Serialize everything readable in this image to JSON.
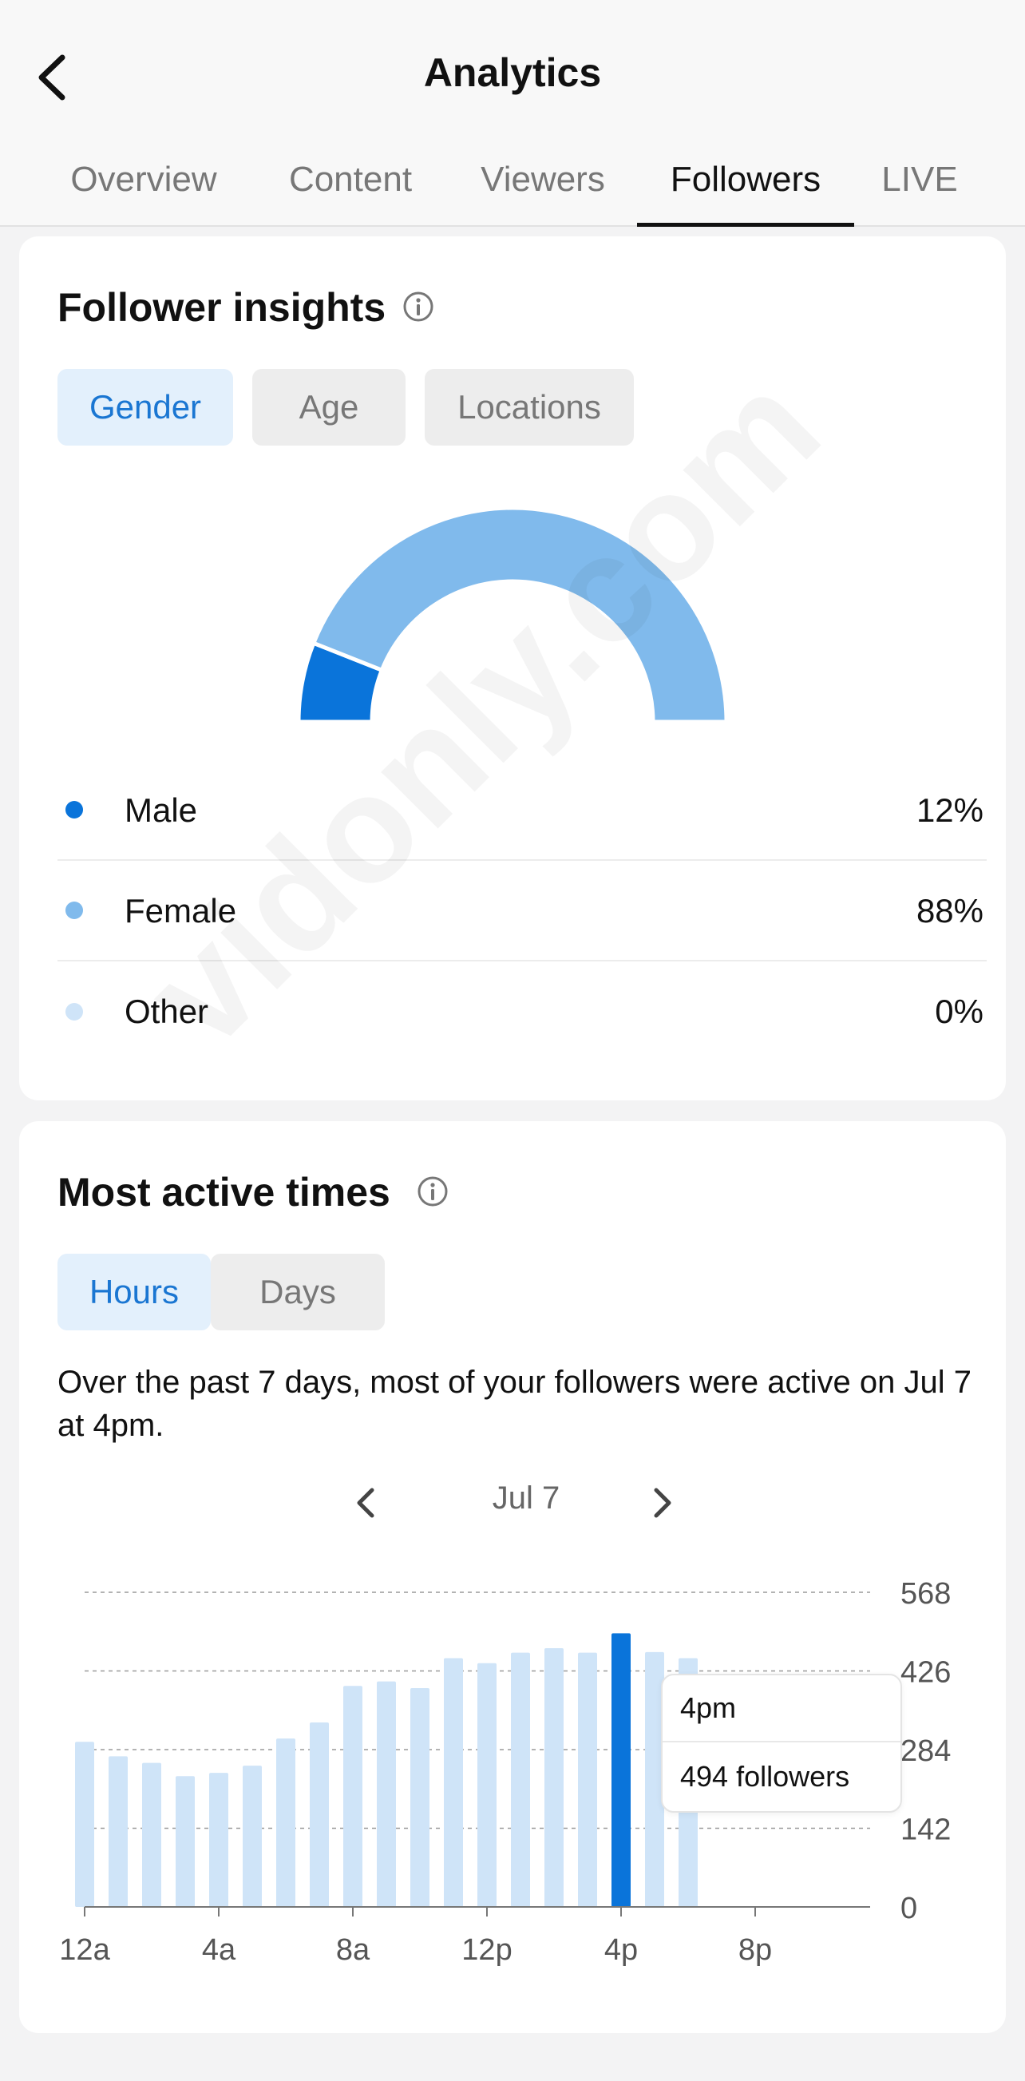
{
  "header": {
    "title": "Analytics",
    "tabs": [
      {
        "label": "Overview"
      },
      {
        "label": "Content"
      },
      {
        "label": "Viewers"
      },
      {
        "label": "Followers"
      },
      {
        "label": "LIVE"
      }
    ],
    "active_tab": "Followers"
  },
  "follower_insights": {
    "title": "Follower insights",
    "filters": [
      {
        "label": "Gender"
      },
      {
        "label": "Age"
      },
      {
        "label": "Locations"
      }
    ],
    "active_filter": "Gender",
    "legend": [
      {
        "label": "Male",
        "value": "12%",
        "color": "#0a74da"
      },
      {
        "label": "Female",
        "value": "88%",
        "color": "#80baec"
      },
      {
        "label": "Other",
        "value": "0%",
        "color": "#cfe4f8"
      }
    ]
  },
  "most_active": {
    "title": "Most active times",
    "filters": [
      {
        "label": "Hours"
      },
      {
        "label": "Days"
      }
    ],
    "active_filter": "Hours",
    "description": "Over the past 7 days, most of your followers were active on Jul 7 at 4pm.",
    "date": "Jul 7",
    "tooltip": {
      "time": "4pm",
      "count": "494 followers"
    }
  },
  "watermark": "vidonly.com",
  "colors": {
    "accent": "#0a74da",
    "bar_light": "#cfe4f8",
    "pill_active_bg": "#e3f0fc"
  },
  "chart_data": [
    {
      "type": "pie",
      "variant": "semi-donut",
      "categories": [
        "Male",
        "Female",
        "Other"
      ],
      "values": [
        12,
        88,
        0
      ],
      "unit": "%"
    },
    {
      "type": "bar",
      "x_unit": "hour",
      "categories": [
        "12a",
        "1a",
        "2a",
        "3a",
        "4a",
        "5a",
        "6a",
        "7a",
        "8a",
        "9a",
        "10a",
        "11a",
        "12p",
        "1p",
        "2p",
        "3p",
        "4p",
        "5p",
        "6p"
      ],
      "values": [
        298,
        272,
        260,
        236,
        242,
        255,
        304,
        333,
        399,
        407,
        395,
        449,
        440,
        459,
        467,
        459,
        494,
        460,
        449
      ],
      "highlight_index": 16,
      "xticks": [
        "12a",
        "4a",
        "8a",
        "12p",
        "4p",
        "8p"
      ],
      "yticks": [
        0,
        142,
        284,
        426,
        568
      ],
      "ylim": [
        0,
        568
      ],
      "grid": true
    }
  ]
}
